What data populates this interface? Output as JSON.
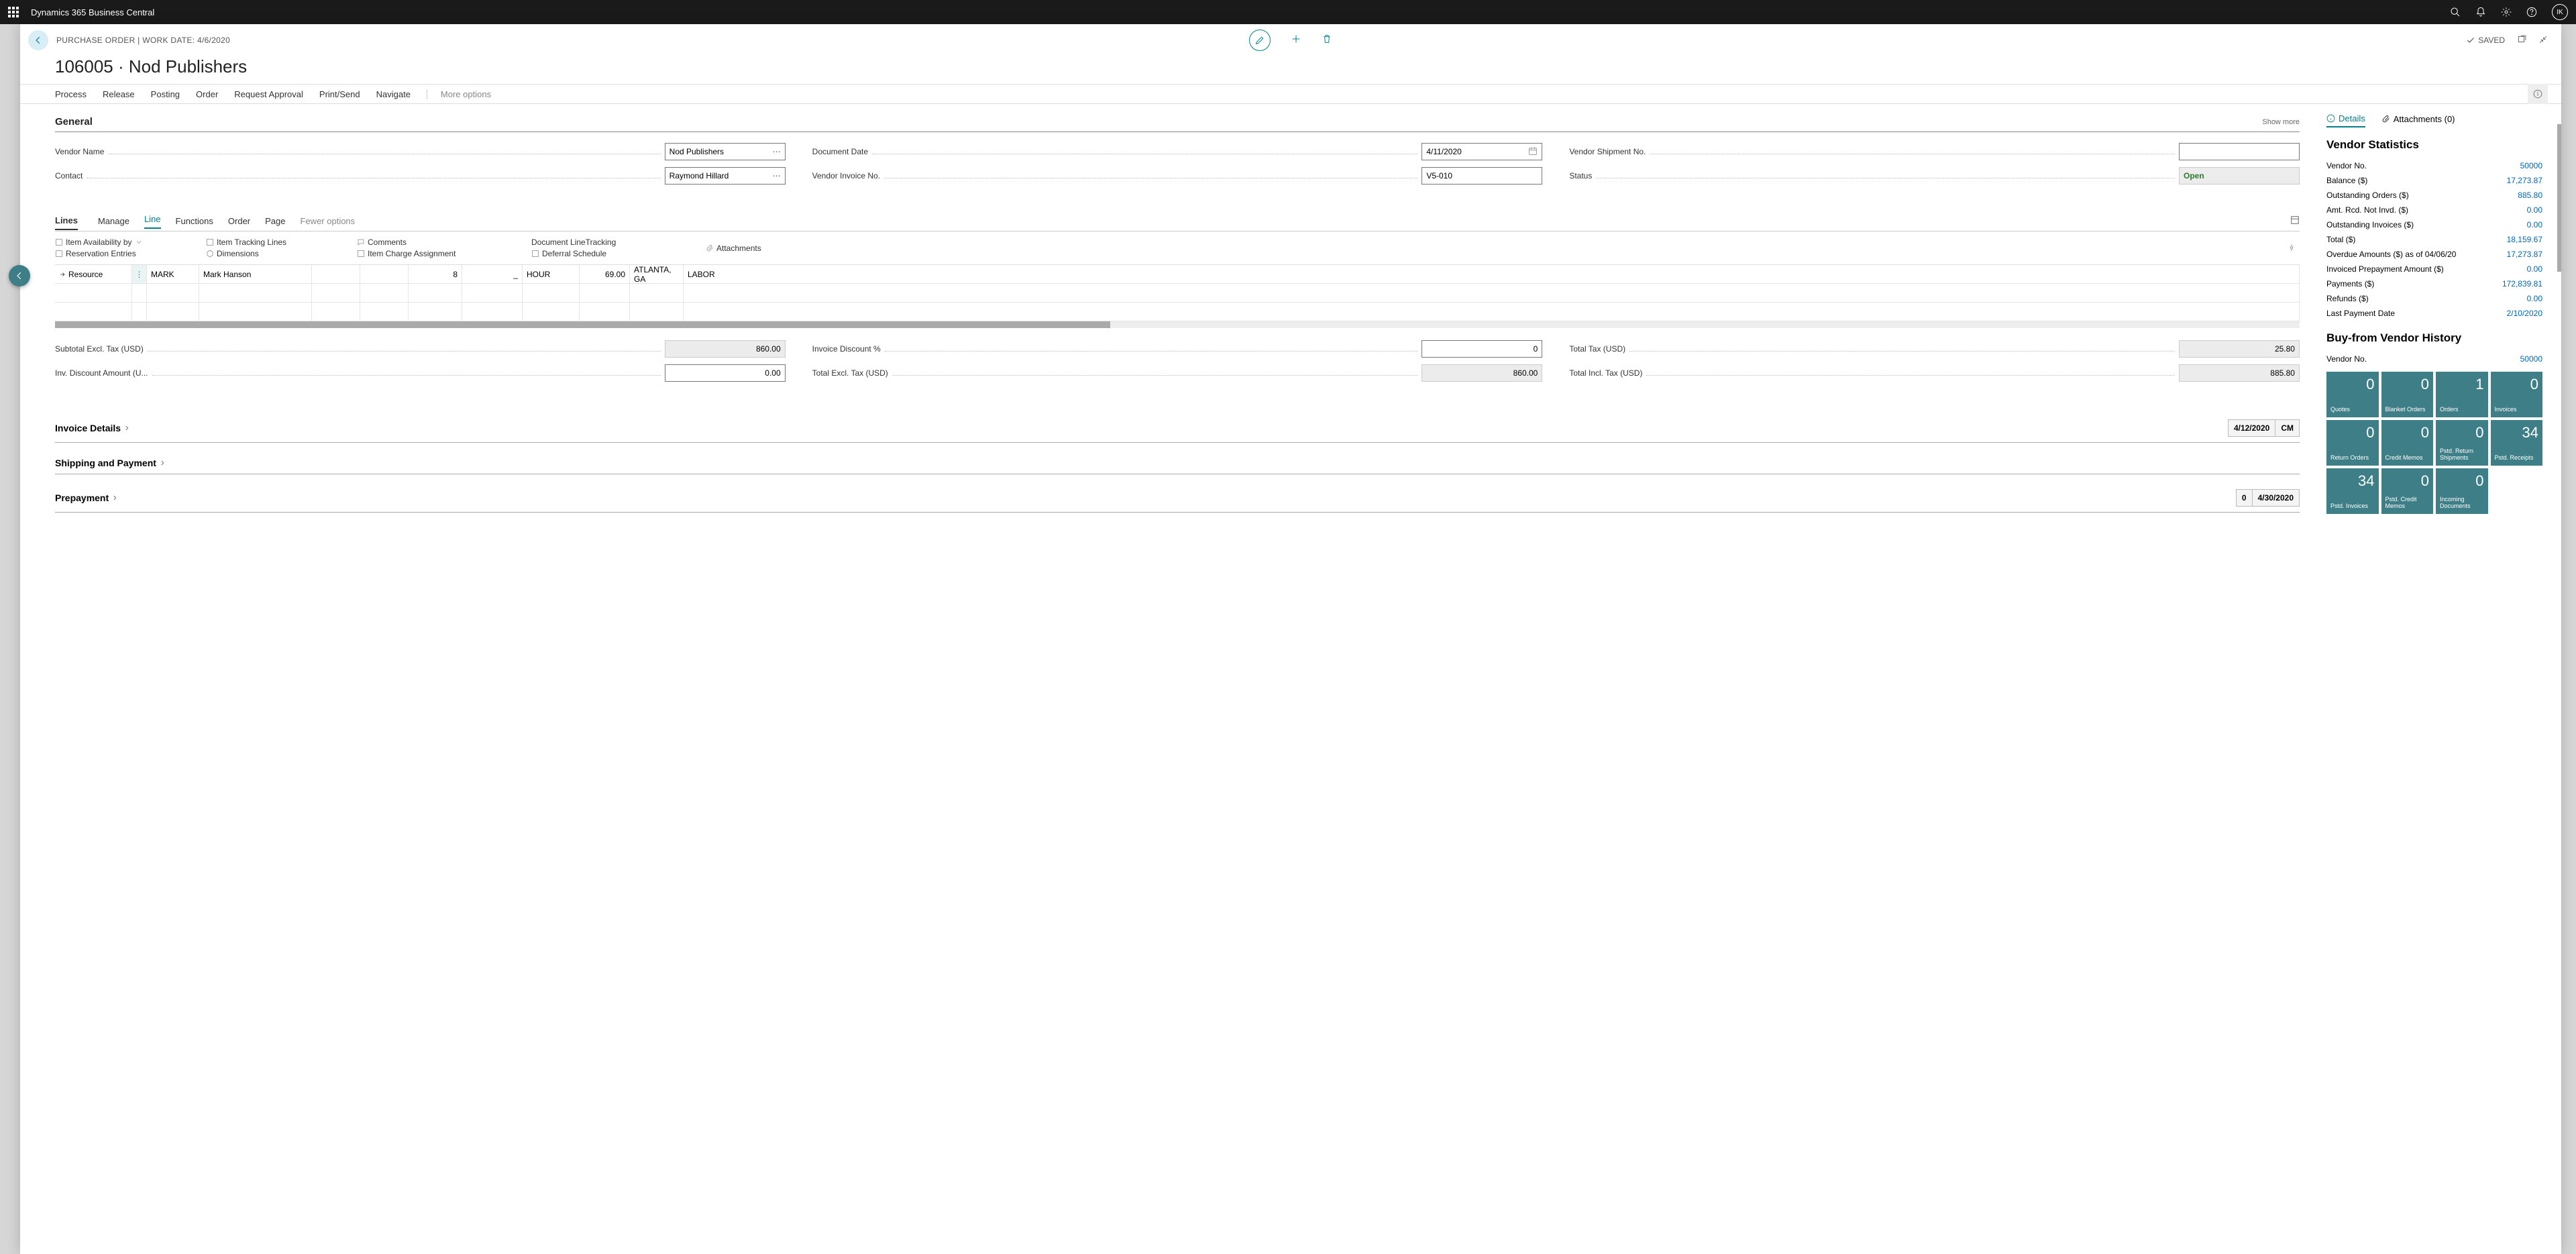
{
  "topbar": {
    "title": "Dynamics 365 Business Central",
    "avatar": "IK"
  },
  "breadcrumb": "PURCHASE ORDER | WORK DATE: 4/6/2020",
  "saved_label": "SAVED",
  "page_title": "106005 · Nod Publishers",
  "actions": {
    "process": "Process",
    "release": "Release",
    "posting": "Posting",
    "order": "Order",
    "request": "Request Approval",
    "print": "Print/Send",
    "navigate": "Navigate",
    "more": "More options"
  },
  "general": {
    "heading": "General",
    "show_more": "Show more",
    "vendor_name_l": "Vendor Name",
    "vendor_name": "Nod Publishers",
    "contact_l": "Contact",
    "contact": "Raymond Hillard",
    "doc_date_l": "Document Date",
    "doc_date": "4/11/2020",
    "vend_inv_l": "Vendor Invoice No.",
    "vend_inv": "V5-010",
    "ship_no_l": "Vendor Shipment No.",
    "ship_no": "",
    "status_l": "Status",
    "status": "Open"
  },
  "lines": {
    "title": "Lines",
    "manage": "Manage",
    "line": "Line",
    "functions": "Functions",
    "order": "Order",
    "page": "Page",
    "fewer": "Fewer options",
    "sub": {
      "avail": "Item Availability by",
      "reserv": "Reservation Entries",
      "track": "Item Tracking Lines",
      "dim": "Dimensions",
      "comm": "Comments",
      "charge": "Item Charge Assignment",
      "doctrack": "Document LineTracking",
      "defer": "Deferral Schedule",
      "attach": "Attachments"
    },
    "row": {
      "type": "Resource",
      "no": "MARK",
      "desc": "Mark Hanson",
      "qty": "8",
      "uom_sym": "_",
      "uom": "HOUR",
      "cost": "69.00",
      "loc": "ATLANTA, GA",
      "tax": "LABOR"
    }
  },
  "totals": {
    "subtotal_l": "Subtotal Excl. Tax (USD)",
    "subtotal": "860.00",
    "disc_amt_l": "Inv. Discount Amount (U...",
    "disc_amt": "0.00",
    "disc_pct_l": "Invoice Discount %",
    "disc_pct": "0",
    "total_excl_l": "Total Excl. Tax (USD)",
    "total_excl": "860.00",
    "total_tax_l": "Total Tax (USD)",
    "total_tax": "25.80",
    "total_incl_l": "Total Incl. Tax (USD)",
    "total_incl": "885.80"
  },
  "collapse": {
    "invoice": "Invoice Details",
    "invoice_date": "4/12/2020",
    "invoice_cm": "CM",
    "shipping": "Shipping and Payment",
    "prepay": "Prepayment",
    "prepay_v": "0",
    "prepay_d": "4/30/2020"
  },
  "side": {
    "details": "Details",
    "attachments": "Attachments (0)",
    "stats_h": "Vendor Statistics",
    "s": [
      {
        "l": "Vendor No.",
        "v": "50000"
      },
      {
        "l": "Balance ($)",
        "v": "17,273.87"
      },
      {
        "l": "Outstanding Orders ($)",
        "v": "885.80"
      },
      {
        "l": "Amt. Rcd. Not Invd. ($)",
        "v": "0.00"
      },
      {
        "l": "Outstanding Invoices ($)",
        "v": "0.00"
      },
      {
        "l": "Total ($)",
        "v": "18,159.67"
      },
      {
        "l": "Overdue Amounts ($) as of 04/06/20",
        "v": "17,273.87"
      },
      {
        "l": "Invoiced Prepayment Amount ($)",
        "v": "0.00"
      },
      {
        "l": "Payments ($)",
        "v": "172,839.81"
      },
      {
        "l": "Refunds ($)",
        "v": "0.00"
      },
      {
        "l": "Last Payment Date",
        "v": "2/10/2020"
      }
    ],
    "hist_h": "Buy-from Vendor History",
    "hist_vno_l": "Vendor No.",
    "hist_vno": "50000",
    "tiles": [
      {
        "n": "0",
        "l": "Quotes"
      },
      {
        "n": "0",
        "l": "Blanket Orders"
      },
      {
        "n": "1",
        "l": "Orders"
      },
      {
        "n": "0",
        "l": "Invoices"
      },
      {
        "n": "0",
        "l": "Return Orders"
      },
      {
        "n": "0",
        "l": "Credit Memos"
      },
      {
        "n": "0",
        "l": "Pstd. Return Shipments"
      },
      {
        "n": "34",
        "l": "Pstd. Receipts"
      },
      {
        "n": "34",
        "l": "Pstd. Invoices"
      },
      {
        "n": "0",
        "l": "Pstd. Credit Memos"
      },
      {
        "n": "0",
        "l": "Incoming Documents"
      }
    ]
  }
}
